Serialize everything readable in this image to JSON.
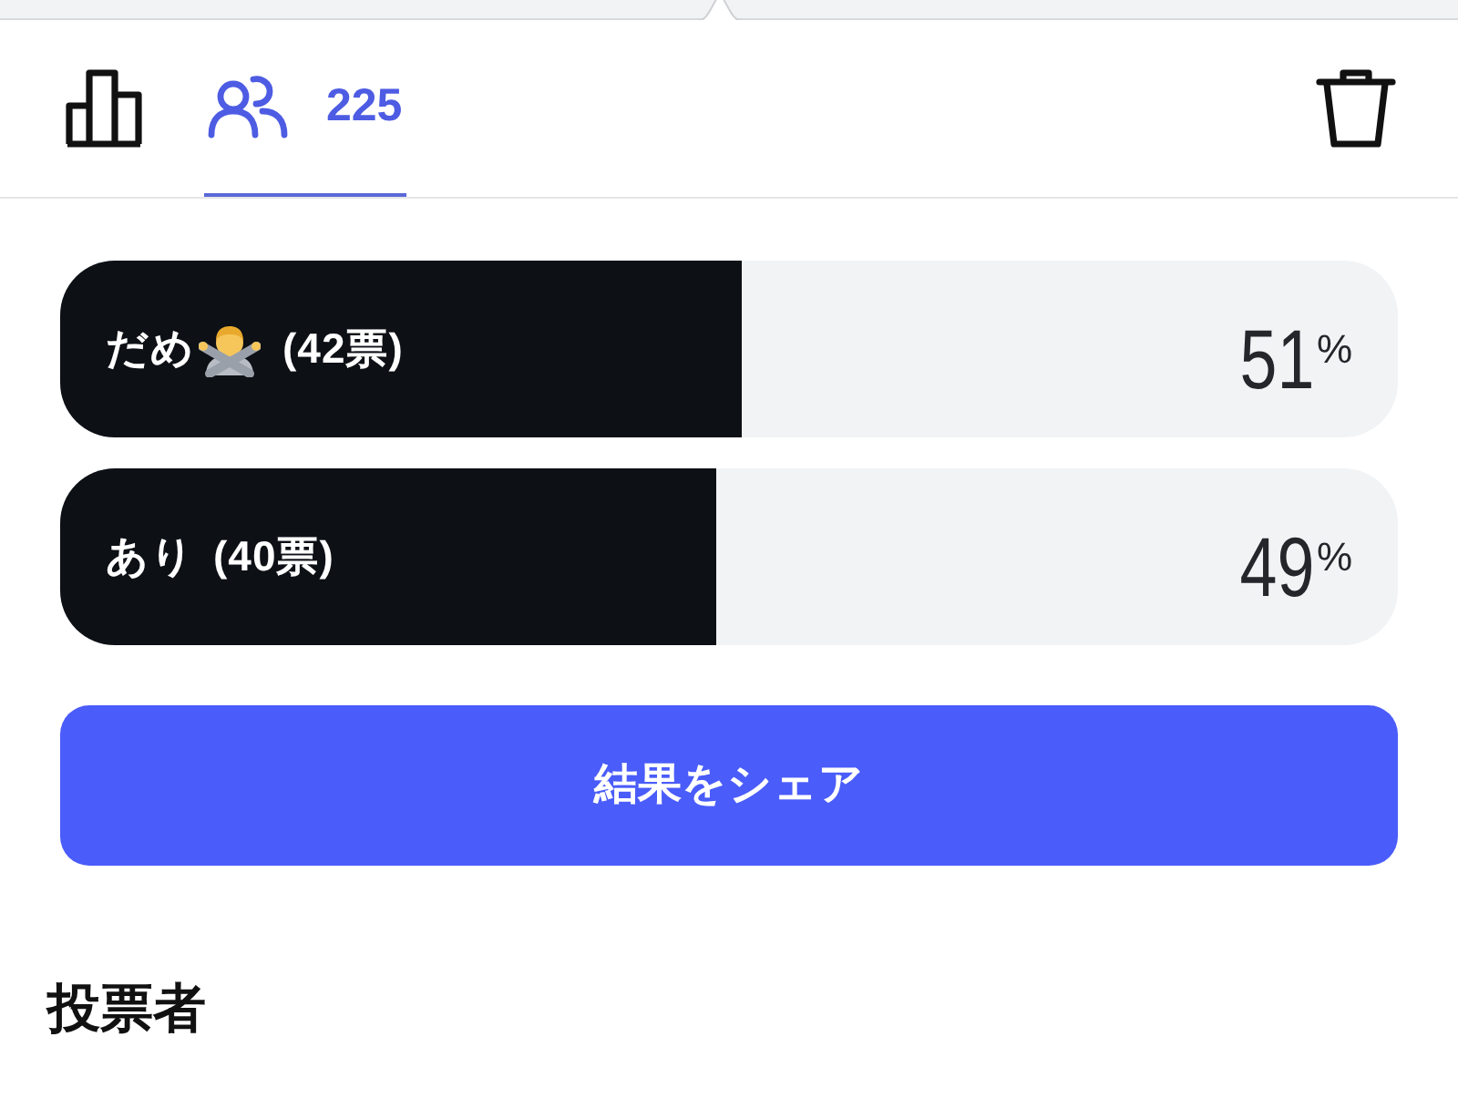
{
  "tabs": [
    {
      "kind": "chart",
      "selected": false
    },
    {
      "kind": "voters",
      "count": "225",
      "selected": true
    }
  ],
  "options": [
    {
      "label": "だめ",
      "emoji": true,
      "votes": "(42票)",
      "percent": "51",
      "unit": "%",
      "level": 0.51
    },
    {
      "label": "あり",
      "emoji": false,
      "votes": "(40票)",
      "percent": "49",
      "unit": "%",
      "level": 0.49
    }
  ],
  "share_button": "結果をシェア",
  "voters_heading": "投票者"
}
